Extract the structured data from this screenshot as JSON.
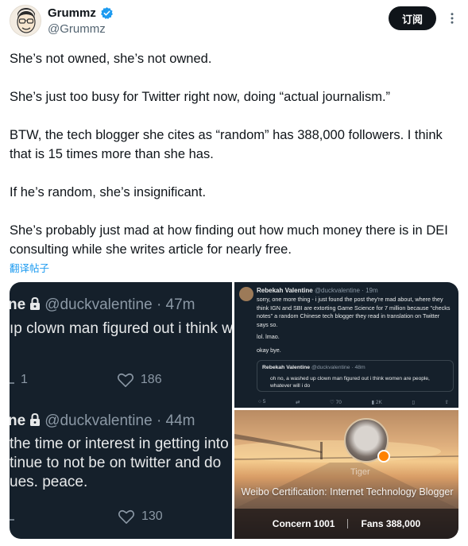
{
  "header": {
    "display_name": "Grummz",
    "handle": "@Grummz",
    "follow_label": "订阅"
  },
  "tweet": {
    "paragraphs": [
      "She’s not owned, she’s not owned.",
      "She’s just too busy for Twitter right now, doing “actual journalism.”",
      "BTW, the tech blogger she cites as “random” has 388,000 followers. I think that is 15 times more than she has.",
      "If he’s random, she’s insignificant.",
      "She’s probably just mad at how finding out how much money there is in DEI consulting while she writes article for nearly free."
    ],
    "translate_label": "翻译帖子"
  },
  "media": {
    "left": {
      "post1": {
        "name_fragment": "ne",
        "handle_time": "@duckvalentine · 47m",
        "text": "ıp clown man figured out i think w",
        "retweets": "1",
        "likes": "186"
      },
      "post2": {
        "name_fragment": "ne",
        "handle_time": "@duckvalentine · 44m",
        "line1": "the time or interest in getting into",
        "line2": "tinue to not be on twitter and do",
        "line3": "ues. peace.",
        "likes": "130"
      }
    },
    "top_right": {
      "name": "Rebekah Valentine",
      "handle_time": "@duckvalentine · 19m",
      "text_lines": [
        "sorry, one more thing - i just found the post they're mad about, where they",
        "think IGN and SBI are extorting Game Science for 7 million because \"checks",
        "notes\" a random Chinese tech blogger they read in translation on Twitter",
        "says so."
      ],
      "line_lol": "lol. lmao.",
      "line_bye": "okay bye.",
      "quote": {
        "name": "Rebekah Valentine",
        "handle_time": "@duckvalentine · 48m",
        "text": "oh no, a washed up clown man figured out i think women are people, whatever will i do"
      },
      "metrics": {
        "replies": "5",
        "likes": "70",
        "views": "2K"
      }
    },
    "bottom_right": {
      "name": "Tiger",
      "certification": "Weibo Certification: Internet Technology Blogger",
      "concern": "Concern 1001",
      "fans": "Fans 388,000"
    }
  },
  "colors": {
    "link_blue": "#1d9bf0",
    "dark_bg": "#15202b",
    "verified_blue": "#1d9bf0"
  }
}
